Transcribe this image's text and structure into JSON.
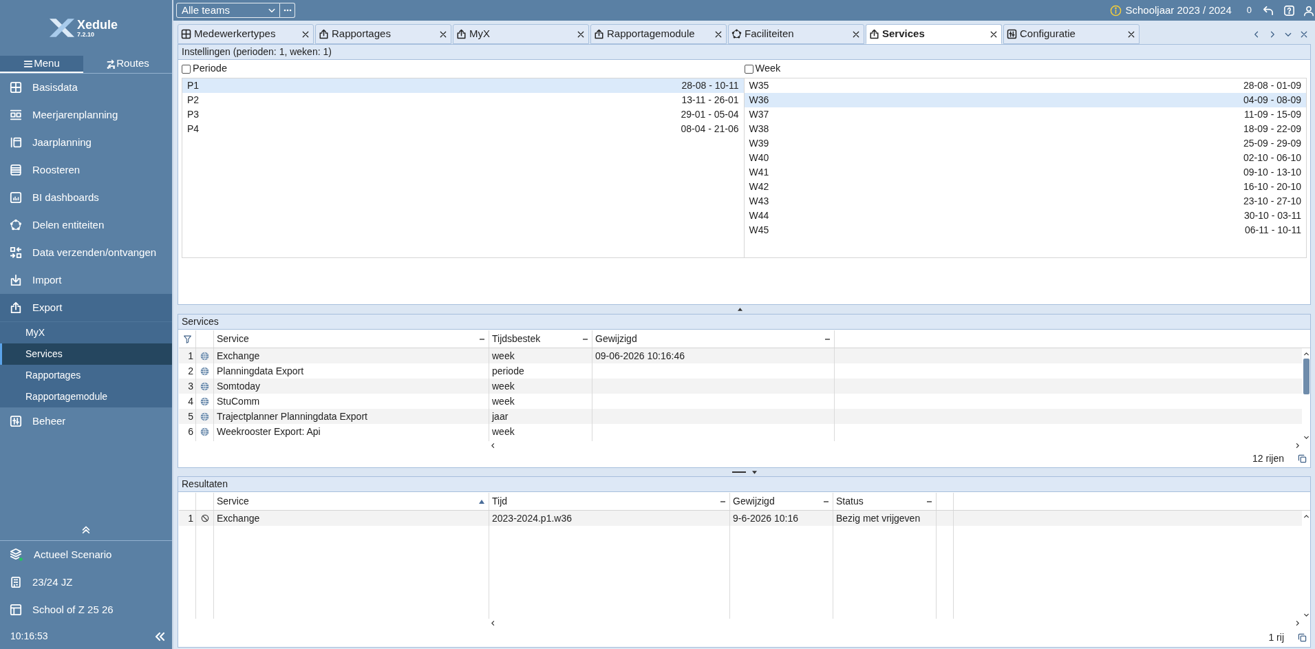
{
  "sidebar": {
    "logo": {
      "name": "Xedule",
      "version": "7.2.10"
    },
    "tabs": [
      {
        "label": "Menu",
        "selected": true
      },
      {
        "label": "Routes",
        "selected": false
      }
    ],
    "items": [
      {
        "label": "Basisdata",
        "expanded": false
      },
      {
        "label": "Meerjarenplanning",
        "expanded": false
      },
      {
        "label": "Jaarplanning",
        "expanded": false
      },
      {
        "label": "Roosteren",
        "expanded": false
      },
      {
        "label": "BI dashboards",
        "expanded": false
      },
      {
        "label": "Delen entiteiten",
        "expanded": false
      },
      {
        "label": "Data verzenden/ontvangen",
        "expanded": false
      },
      {
        "label": "Import",
        "expanded": false
      },
      {
        "label": "Export",
        "expanded": true,
        "children": [
          {
            "label": "MyX",
            "selected": false
          },
          {
            "label": "Services",
            "selected": true
          },
          {
            "label": "Rapportages",
            "selected": false
          },
          {
            "label": "Rapportagemodule",
            "selected": false
          }
        ]
      },
      {
        "label": "Beheer",
        "expanded": false
      }
    ],
    "footer": [
      {
        "label": "Actueel Scenario"
      },
      {
        "label": "23/24 JZ"
      },
      {
        "label": "School of Z 25 26"
      }
    ],
    "clock": "10:16:53"
  },
  "top_bar": {
    "team_select": "Alle teams",
    "school_year": "Schooljaar 2023 / 2024",
    "count": "0"
  },
  "tabs": [
    {
      "label": "Medewerkertypes",
      "selected": false
    },
    {
      "label": "Rapportages",
      "selected": false
    },
    {
      "label": "MyX",
      "selected": false
    },
    {
      "label": "Rapportagemodule",
      "selected": false
    },
    {
      "label": "Faciliteiten",
      "selected": false
    },
    {
      "label": "Services",
      "selected": true
    },
    {
      "label": "Configuratie",
      "selected": false
    }
  ],
  "settings": {
    "title": "Instellingen (perioden: 1, weken: 1)",
    "lists": [
      {
        "label": "Periode",
        "checked": false,
        "rows": [
          {
            "name": "P1",
            "dates": "28-08 - 10-11",
            "selected": true
          },
          {
            "name": "P2",
            "dates": "13-11 - 26-01",
            "selected": false
          },
          {
            "name": "P3",
            "dates": "29-01 - 05-04",
            "selected": false
          },
          {
            "name": "P4",
            "dates": "08-04 - 21-06",
            "selected": false
          }
        ]
      },
      {
        "label": "Week",
        "checked": false,
        "rows": [
          {
            "name": "W35",
            "dates": "28-08 - 01-09",
            "selected": false
          },
          {
            "name": "W36",
            "dates": "04-09 - 08-09",
            "selected": true
          },
          {
            "name": "W37",
            "dates": "11-09 - 15-09",
            "selected": false
          },
          {
            "name": "W38",
            "dates": "18-09 - 22-09",
            "selected": false
          },
          {
            "name": "W39",
            "dates": "25-09 - 29-09",
            "selected": false
          },
          {
            "name": "W40",
            "dates": "02-10 - 06-10",
            "selected": false
          },
          {
            "name": "W41",
            "dates": "09-10 - 13-10",
            "selected": false
          },
          {
            "name": "W42",
            "dates": "16-10 - 20-10",
            "selected": false
          },
          {
            "name": "W43",
            "dates": "23-10 - 27-10",
            "selected": false
          },
          {
            "name": "W44",
            "dates": "30-10 - 03-11",
            "selected": false
          },
          {
            "name": "W45",
            "dates": "06-11 - 10-11",
            "selected": false
          }
        ]
      }
    ]
  },
  "services": {
    "title": "Services",
    "columns": [
      {
        "label": "Service"
      },
      {
        "label": "Tijdsbestek"
      },
      {
        "label": "Gewijzigd"
      }
    ],
    "rows": [
      {
        "number": "1",
        "service": "Exchange",
        "timeframe": "week",
        "modified": "09-06-2026 10:16:46"
      },
      {
        "number": "2",
        "service": "Planningdata Export",
        "timeframe": "periode"
      },
      {
        "number": "3",
        "service": "Somtoday",
        "timeframe": "week"
      },
      {
        "number": "4",
        "service": "StuComm",
        "timeframe": "week"
      },
      {
        "number": "5",
        "service": "Trajectplanner Planningdata Export",
        "timeframe": "jaar"
      },
      {
        "number": "6",
        "service": "Weekrooster Export: Api",
        "timeframe": "week"
      }
    ],
    "row_count": "12 rijen"
  },
  "results": {
    "title": "Resultaten",
    "columns": [
      {
        "label": "Service",
        "sorted": true
      },
      {
        "label": "Tijd",
        "sorted": false
      },
      {
        "label": "Gewijzigd",
        "sorted": false
      },
      {
        "label": "Status",
        "sorted": false
      }
    ],
    "rows": [
      {
        "number": "1",
        "service": "Exchange",
        "time": "2023-2024.p1.w36",
        "modified": "9-6-2026 10:16",
        "status": "Bezig met vrijgeven"
      }
    ],
    "row_count": "1 rij"
  }
}
